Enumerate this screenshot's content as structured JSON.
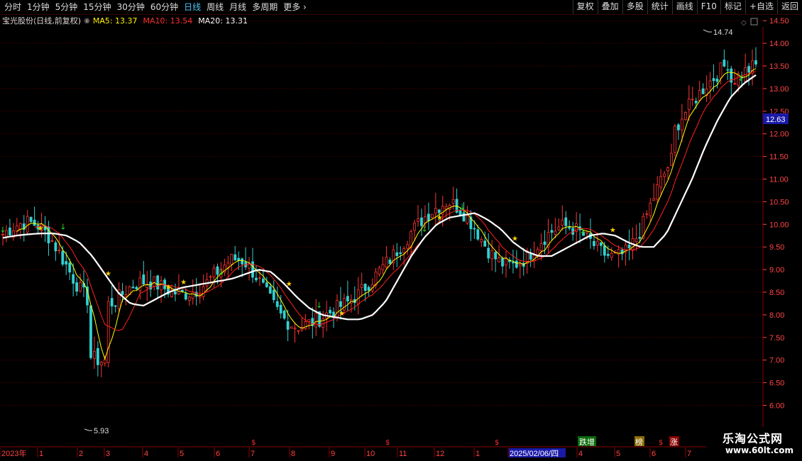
{
  "toolbar": {
    "periods": [
      "分时",
      "1分钟",
      "5分钟",
      "15分钟",
      "30分钟",
      "60分钟",
      "日线",
      "周线",
      "月线",
      "多周期",
      "更多"
    ],
    "active_period": "日线",
    "more_arrow": "›",
    "buttons": [
      "复权",
      "叠加",
      "多股",
      "统计",
      "画线",
      "F10",
      "标记",
      "+自选",
      "返回"
    ]
  },
  "info": {
    "stock_name": "宝光股份(日线,前复权)",
    "ma5_label": "MA5: 13.37",
    "ma10_label": "MA10: 13.54",
    "ma20_label": "MA20: 13.31",
    "icons": [
      "diamond-icon",
      "square-icon"
    ]
  },
  "colors": {
    "up": "#ff3333",
    "down": "#33d0d0",
    "ma5": "#ffff00",
    "ma10": "#ff2020",
    "ma20": "#ffffff",
    "grid": "#5a0000",
    "axis_text": "#ff4444",
    "price_badge_bg": "#1a1aa8"
  },
  "price_axis": {
    "ticks": [
      "14.50",
      "14.00",
      "13.50",
      "13.00",
      "12.50",
      "12.00",
      "11.50",
      "11.00",
      "10.50",
      "10.00",
      "9.50",
      "9.00",
      "8.50",
      "8.00",
      "7.50",
      "7.00",
      "6.50",
      "6.00"
    ],
    "current_price": "12.63",
    "high_label": "14.74",
    "low_label": "5.93"
  },
  "time_axis": {
    "labels": [
      "2023年",
      "1",
      "2",
      "3",
      "4",
      "5",
      "6",
      "7",
      "8",
      "9",
      "10",
      "11",
      "12",
      "1",
      "2025/02/06/四",
      "4",
      "5",
      "6",
      "7"
    ]
  },
  "markers": {
    "dollar": "$",
    "event_labels": [
      "跌增",
      "榜",
      "$",
      "涨"
    ]
  },
  "watermark": {
    "line1": "乐淘公式网",
    "line2": "www.60lt.com"
  },
  "chart_data": {
    "type": "candlestick",
    "series_labels": [
      "MA5",
      "MA10",
      "MA20"
    ],
    "ylim": [
      6.0,
      14.74
    ],
    "high": 14.74,
    "low": 5.93,
    "last_close": 12.63,
    "ma5_last": 13.37,
    "ma10_last": 13.54,
    "ma20_last": 13.31,
    "ma20_path": [
      9.7,
      9.75,
      9.78,
      9.8,
      9.8,
      9.75,
      9.6,
      9.3,
      8.9,
      8.5,
      8.25,
      8.2,
      8.35,
      8.5,
      8.6,
      8.65,
      8.7,
      8.75,
      8.8,
      8.9,
      9.0,
      8.95,
      8.7,
      8.4,
      8.15,
      8.0,
      7.95,
      7.9,
      7.9,
      8.0,
      8.3,
      8.8,
      9.3,
      9.7,
      10.0,
      10.15,
      10.2,
      10.25,
      10.1,
      9.9,
      9.6,
      9.4,
      9.3,
      9.3,
      9.45,
      9.6,
      9.75,
      9.8,
      9.75,
      9.6,
      9.5,
      9.5,
      9.8,
      10.4,
      11.0,
      11.7,
      12.3,
      12.8,
      13.1,
      13.3
    ]
  }
}
